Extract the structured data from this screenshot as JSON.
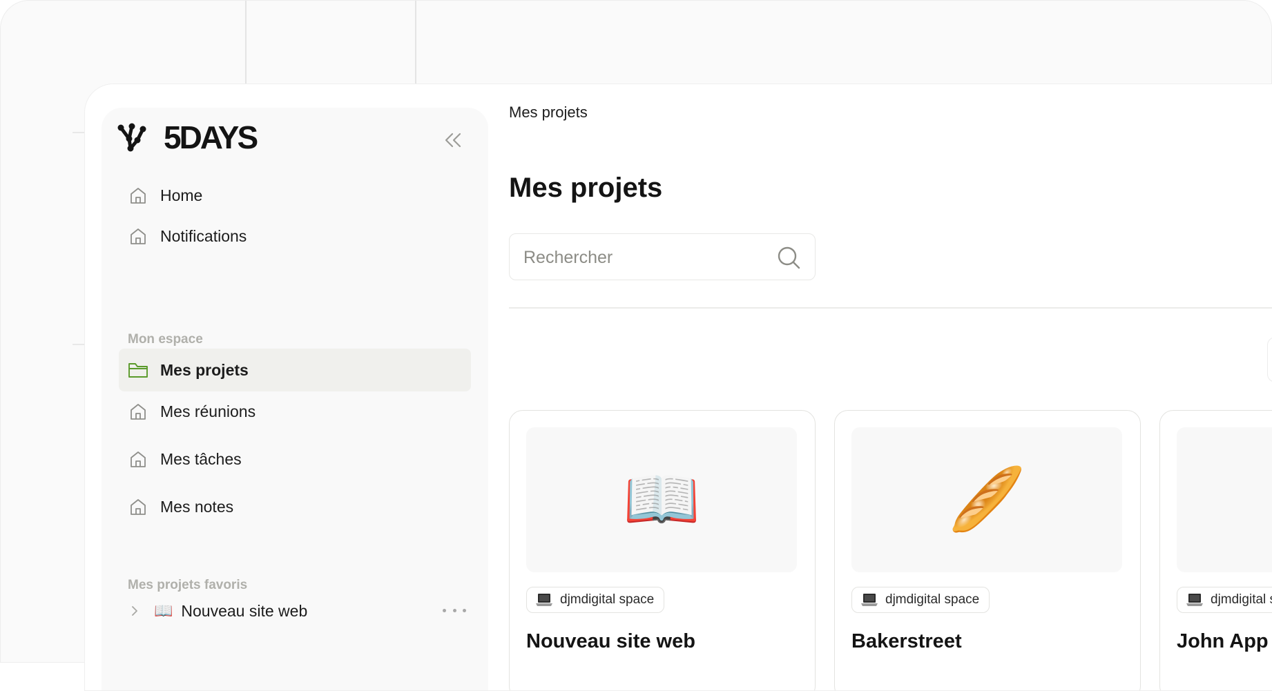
{
  "brand": {
    "name": "5DAYS"
  },
  "sidebar": {
    "nav_top": [
      {
        "label": "Home",
        "icon": "home-icon"
      },
      {
        "label": "Notifications",
        "icon": "home-icon"
      }
    ],
    "section_space": "Mon espace",
    "nav_space": [
      {
        "label": "Mes projets",
        "icon": "folder-icon",
        "active": true
      },
      {
        "label": "Mes réunions",
        "icon": "home-icon"
      },
      {
        "label": "Mes tâches",
        "icon": "home-icon"
      },
      {
        "label": "Mes notes",
        "icon": "home-icon"
      }
    ],
    "section_favorites": "Mes projets favoris",
    "favorites": [
      {
        "emoji": "📖",
        "label": "Nouveau site web"
      }
    ]
  },
  "main": {
    "breadcrumb": "Mes projets",
    "title": "Mes projets",
    "search": {
      "placeholder": "Rechercher",
      "value": ""
    },
    "projects": [
      {
        "emoji": "📖",
        "workspace": "djmdigital space",
        "title": "Nouveau site web"
      },
      {
        "emoji": "🥖",
        "workspace": "djmdigital space",
        "title": "Bakerstreet"
      },
      {
        "emoji": "",
        "workspace": "djmdigital space",
        "title": "John App"
      }
    ]
  },
  "colors": {
    "accent_green": "#5a9a2a",
    "active_bg": "#f0f0ed",
    "section_label": "#b0b0ab",
    "text": "#1c1c1c"
  }
}
